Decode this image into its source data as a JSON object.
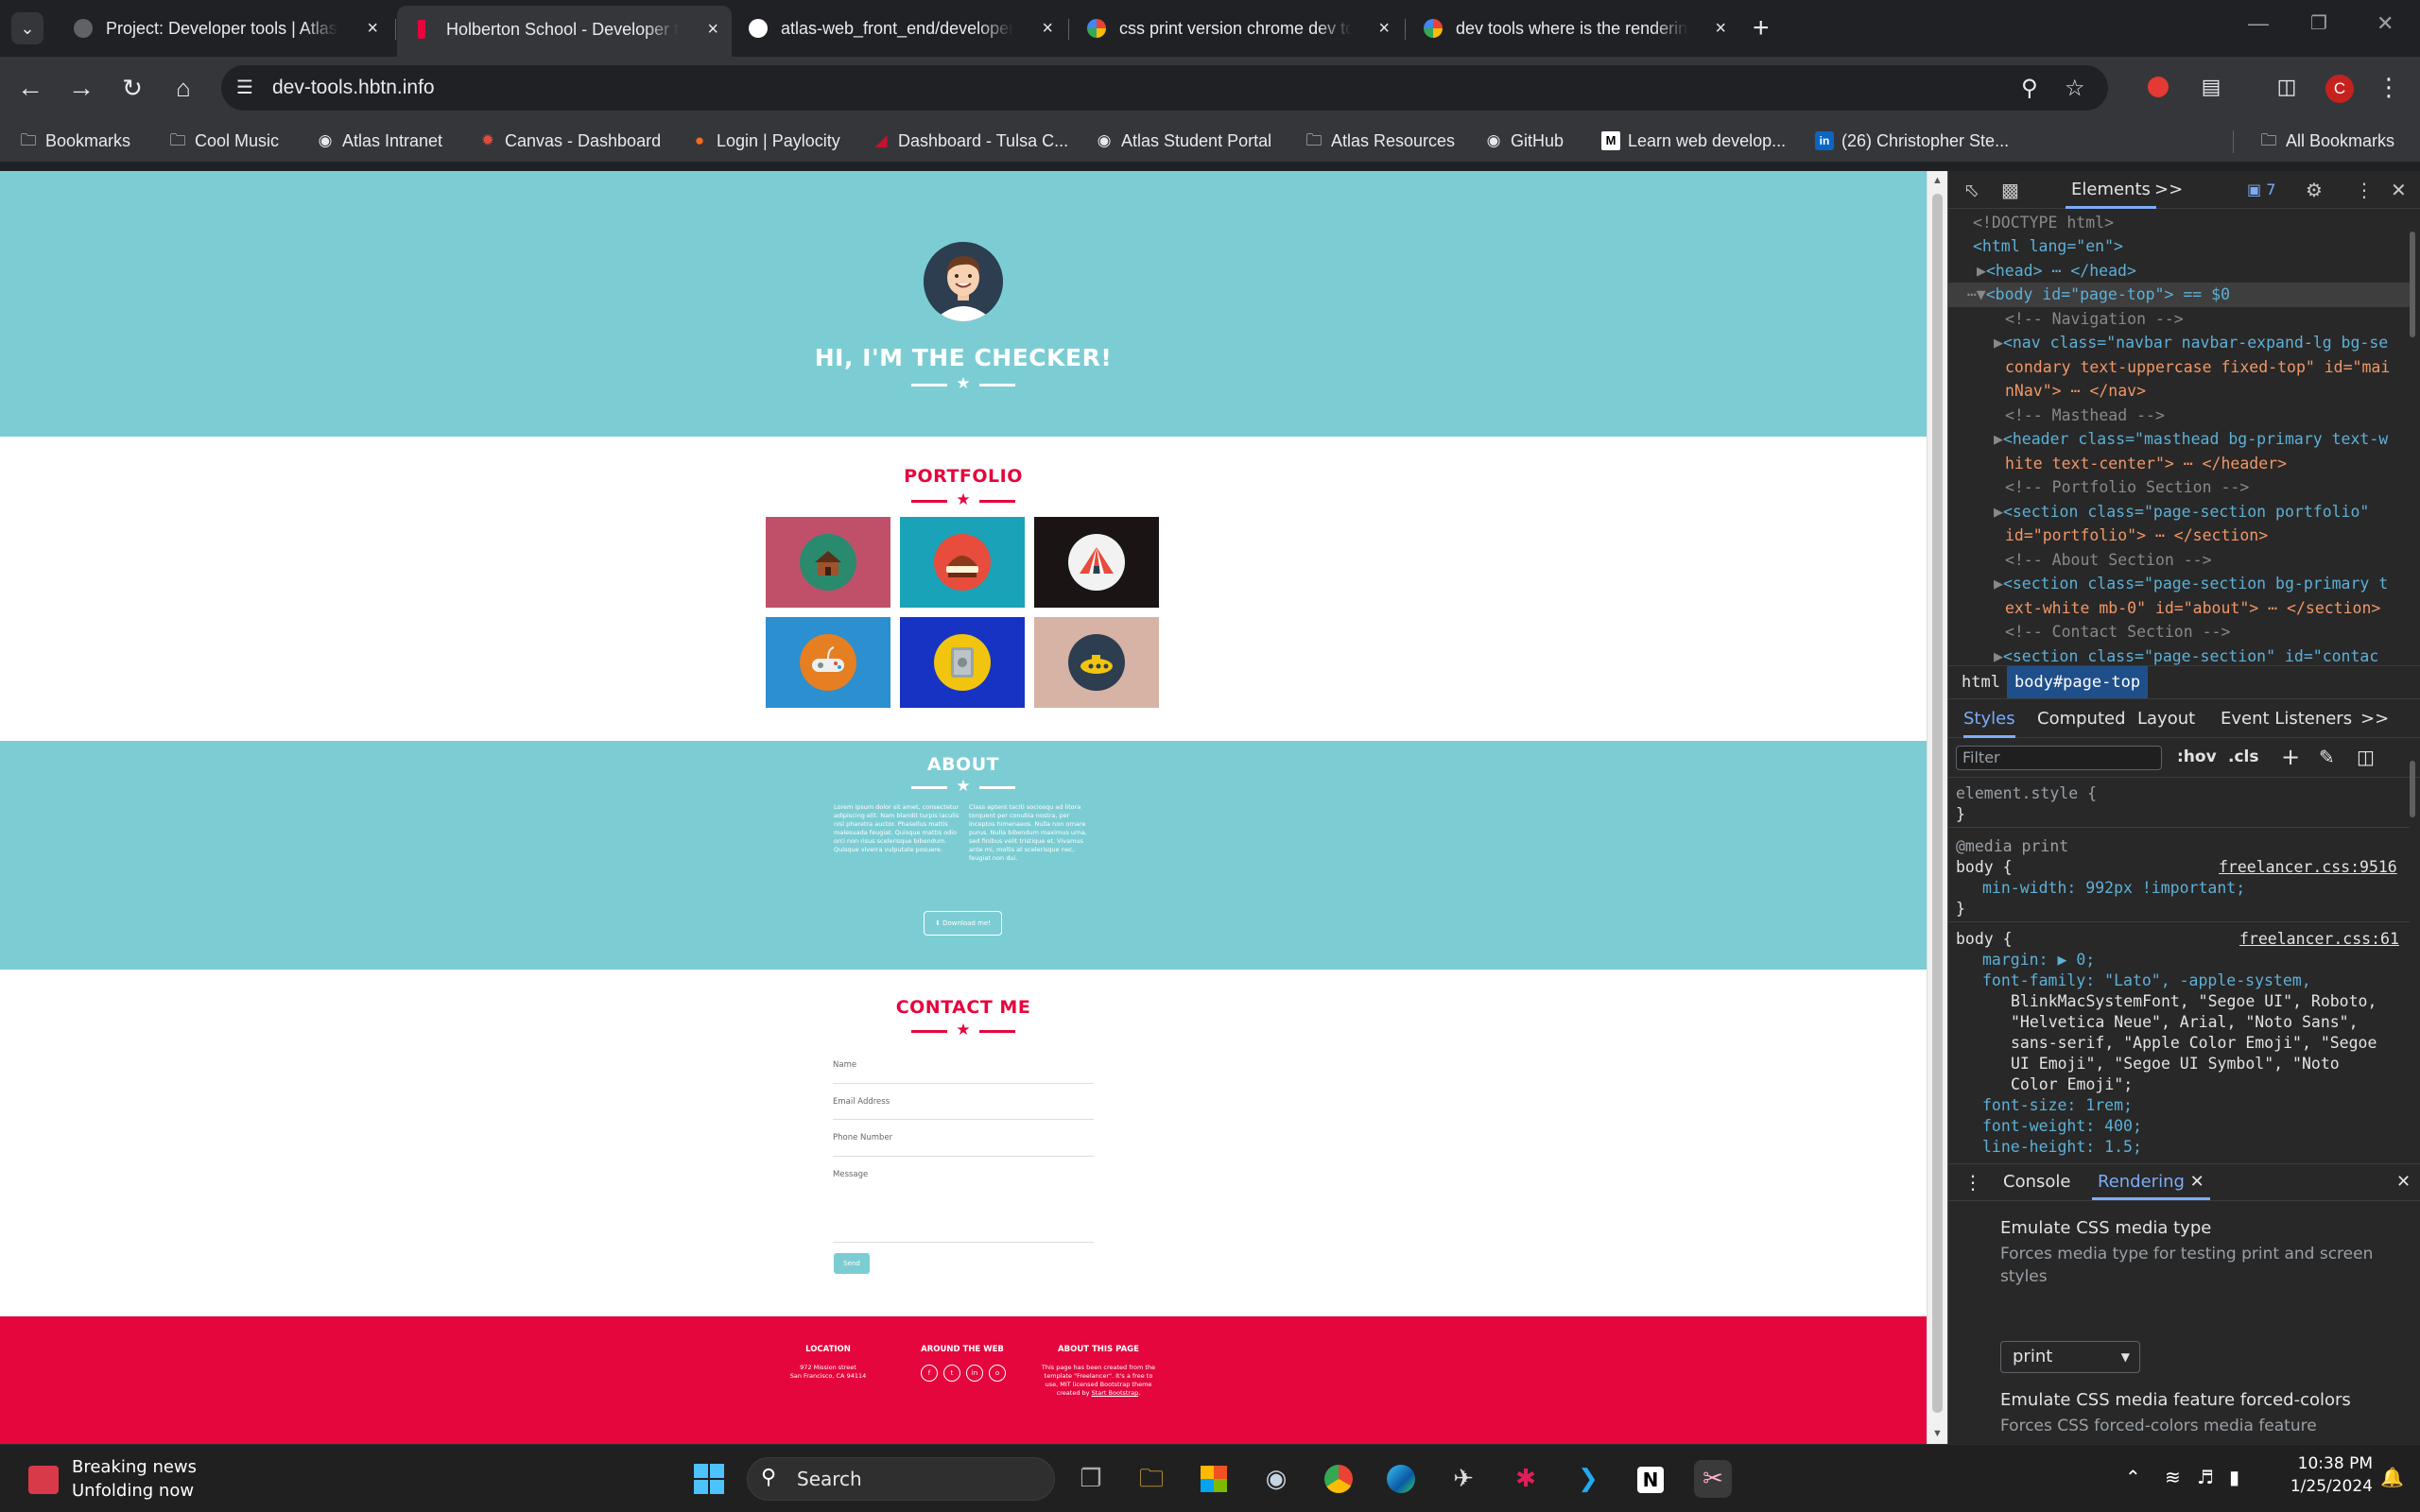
{
  "browser": {
    "tabs": [
      {
        "title": "Project: Developer tools | Atlas",
        "favicon_color": "#8ab4f8"
      },
      {
        "title": "Holberton School - Developer t",
        "favicon_color": "#e5063e"
      },
      {
        "title": "atlas-web_front_end/developer",
        "favicon_color": "#ffffff"
      },
      {
        "title": "css print version chrome dev to",
        "favicon_color": "#4285f4"
      },
      {
        "title": "dev tools where is the rendering",
        "favicon_color": "#4285f4"
      }
    ],
    "active_tab_index": 1,
    "url": "dev-tools.hbtn.info",
    "profile_initial": "C",
    "bookmarks": [
      {
        "label": "Bookmarks",
        "icon": "folder-icon"
      },
      {
        "label": "Cool Music",
        "icon": "folder-icon"
      },
      {
        "label": "Atlas Intranet",
        "icon": "globe-icon"
      },
      {
        "label": "Canvas - Dashboard",
        "icon": "canvas-icon"
      },
      {
        "label": "Login | Paylocity",
        "icon": "paylocity-icon"
      },
      {
        "label": "Dashboard - Tulsa C...",
        "icon": "tcc-icon"
      },
      {
        "label": "Atlas Student Portal",
        "icon": "globe-icon"
      },
      {
        "label": "Atlas Resources",
        "icon": "folder-icon"
      },
      {
        "label": "GitHub",
        "icon": "github-icon"
      },
      {
        "label": "Learn web develop...",
        "icon": "mdn-icon"
      },
      {
        "label": "(26) Christopher Ste...",
        "icon": "linkedin-icon"
      }
    ],
    "all_bookmarks": "All Bookmarks"
  },
  "site": {
    "headline": "HI, I'M THE CHECKER!",
    "portfolio_title": "PORTFOLIO",
    "portfolio_items": [
      {
        "name": "cabin",
        "bg": "#c0506a",
        "disc": "#2a8a6e"
      },
      {
        "name": "cake",
        "bg": "#1aa3b8",
        "disc": "#e74c3c"
      },
      {
        "name": "circus",
        "bg": "#1a1414",
        "disc": "#f2f2f2"
      },
      {
        "name": "game",
        "bg": "#2b8fd0",
        "disc": "#e67e22"
      },
      {
        "name": "safe",
        "bg": "#1733c4",
        "disc": "#f1c40f"
      },
      {
        "name": "submarine",
        "bg": "#d6b3a4",
        "disc": "#2c3e50"
      }
    ],
    "about_title": "ABOUT",
    "about_left": "Lorem ipsum dolor sit amet, consectetur adipiscing elit. Nam blandit turpis iaculis nisl pharetra auctor. Phasellus mattis malesuada feugiat. Quisque mattis odio orci non risus scelerisque bibendum. Quisque viverra vulputate posuere.",
    "about_right": "Class aptent taciti sociosqu ad litora torquent per conubia nostra, per inceptos himenaeos. Nulla non ornare purus. Nulla bibendum maximus urna, sed finibus velit tristique et. Vivamus ante mi, mollis at scelerisque nec, feugiat non dui.",
    "download_label": "Download me!",
    "contact_title": "CONTACT ME",
    "contact_fields": [
      "Name",
      "Email Address",
      "Phone Number",
      "Message"
    ],
    "send_label": "Send",
    "footer": {
      "location_title": "LOCATION",
      "location_line1": "972 Mission street",
      "location_line2": "San Francisco, CA 94114",
      "web_title": "AROUND THE WEB",
      "social": [
        "f",
        "t",
        "in",
        "o"
      ],
      "about_title": "ABOUT THIS PAGE",
      "about_text": "This page has been created from the template \"Freelancer\". It's a free to use, MIT licensed Bootstrap theme created by",
      "about_link": "Start Bootstrap",
      "about_end": "."
    },
    "colors": {
      "primary": "#7ccdd3",
      "accent": "#e5063e",
      "dark": "#2c3e50"
    }
  },
  "devtools": {
    "tabs": {
      "elements": "Elements",
      "more": ">>",
      "issues_count": "7"
    },
    "dom_lines": {
      "doctype": "<!DOCTYPE html>",
      "html_open": "<html lang=\"en\">",
      "head": "<head> ⋯ </head>",
      "body": "<body id=\"page-top\"> == $0",
      "c_nav": "<!-- Navigation -->",
      "nav_1": "<nav class=\"navbar navbar-expand-lg bg-se",
      "nav_2": "condary text-uppercase fixed-top\" id=\"mai",
      "nav_3": "nNav\"> ⋯ </nav>",
      "c_mast": "<!-- Masthead -->",
      "head_1": "<header class=\"masthead bg-primary text-w",
      "head_2": "hite text-center\"> ⋯ </header>",
      "c_port": "<!-- Portfolio Section -->",
      "port_1": "<section class=\"page-section portfolio\"",
      "port_2": "id=\"portfolio\"> ⋯ </section>",
      "c_about": "<!-- About Section -->",
      "about_1": "<section class=\"page-section bg-primary t",
      "about_2": "ext-white mb-0\" id=\"about\"> ⋯ </section>",
      "c_contact": "<!-- Contact Section -->",
      "contact_1": "<section class=\"page-section\" id=\"contac"
    },
    "breadcrumbs": [
      "html",
      "body#page-top"
    ],
    "sub_tabs": [
      "Styles",
      "Computed",
      "Layout",
      "Event Listeners",
      ">>"
    ],
    "filter_placeholder": "Filter",
    "hov": ":hov",
    "cls": ".cls",
    "styles": {
      "element_style": "element.style {",
      "close": "}",
      "media": "@media print",
      "rule1_selector": "body {",
      "rule1_source": "freelancer.css:9516",
      "rule1_decl": "min-width: 992px !important;",
      "rule2_selector": "body {",
      "rule2_source": "freelancer.css:61",
      "margin": "margin: ▶ 0;",
      "ff_1": "font-family: \"Lato\", -apple-system,",
      "ff_2": "BlinkMacSystemFont, \"Segoe UI\", Roboto,",
      "ff_3": "\"Helvetica Neue\", Arial, \"Noto Sans\",",
      "ff_4": "sans-serif, \"Apple Color Emoji\", \"Segoe",
      "ff_5": "UI Emoji\", \"Segoe UI Symbol\", \"Noto",
      "ff_6": "Color Emoji\";",
      "font_size": "font-size: 1rem;",
      "font_weight": "font-weight: 400;",
      "line_height": "line-height: 1.5;"
    },
    "drawer_tabs": [
      "Console",
      "Rendering"
    ],
    "rendering": {
      "media_title": "Emulate CSS media type",
      "media_desc": "Forces media type for testing print and screen styles",
      "media_value": "print",
      "forced_title": "Emulate CSS media feature forced-colors",
      "forced_desc": "Forces CSS forced-colors media feature"
    }
  },
  "taskbar": {
    "news_title": "Breaking news",
    "news_sub": "Unfolding now",
    "search_label": "Search",
    "time": "10:38 PM",
    "date": "1/25/2024"
  }
}
